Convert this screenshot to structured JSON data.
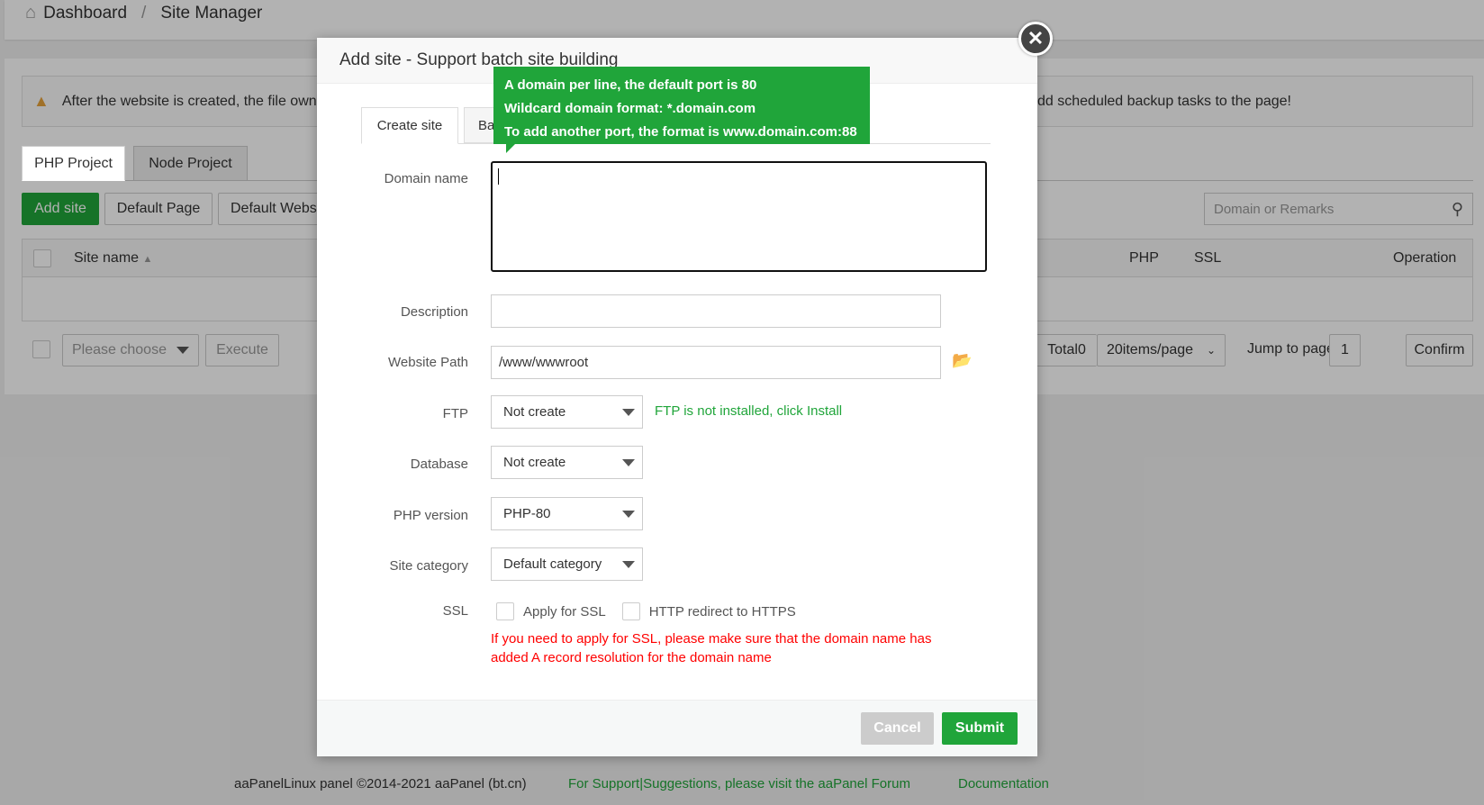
{
  "breadcrumb": {
    "home": "Dashboard",
    "sep": "/",
    "current": "Site Manager"
  },
  "alert": {
    "text_left": "After the website is created, the file own",
    "text_right": "dd scheduled backup tasks to the page!"
  },
  "project_tabs": [
    "PHP Project",
    "Node Project"
  ],
  "toolbar": {
    "add_site": "Add site",
    "default_page": "Default Page",
    "default_website": "Default Webs",
    "search_placeholder": "Domain or Remarks"
  },
  "table": {
    "col_site_name": "Site name",
    "col_php": "PHP",
    "col_ssl": "SSL",
    "col_operation": "Operation"
  },
  "bulk": {
    "select_placeholder": "Please choose",
    "execute": "Execute"
  },
  "pagination": {
    "total": "Total0",
    "per_page": "20items/page",
    "jump_label": "Jump to page",
    "page": "1",
    "confirm": "Confirm"
  },
  "footer": {
    "copyright": "aaPanelLinux panel ©2014-2021 aaPanel (bt.cn)",
    "support": "For Support|Suggestions, please visit the aaPanel Forum",
    "docs": "Documentation"
  },
  "modal": {
    "title": "Add site - Support batch site building",
    "tabs": [
      "Create site",
      "Ba"
    ],
    "tooltip": [
      "A domain per line, the default port is 80",
      "Wildcard domain format: *.domain.com",
      "To add another port, the format is www.domain.com:88"
    ],
    "labels": {
      "domain": "Domain name",
      "description": "Description",
      "path": "Website Path",
      "ftp": "FTP",
      "database": "Database",
      "php": "PHP version",
      "category": "Site category",
      "ssl": "SSL"
    },
    "values": {
      "domain": "",
      "description": "",
      "path": "/www/wwwroot",
      "ftp": "Not create",
      "database": "Not create",
      "php": "PHP-80",
      "category": "Default category"
    },
    "ftp_note": "FTP is not installed, click Install",
    "ssl_apply": "Apply for SSL",
    "ssl_redirect": "HTTP redirect to HTTPS",
    "ssl_warning_1": "If you need to apply for SSL, please make sure that the domain name has",
    "ssl_warning_2": "added A record resolution for the domain name",
    "cancel": "Cancel",
    "submit": "Submit"
  },
  "colors": {
    "green": "#20a53a",
    "red": "#ff0000"
  }
}
